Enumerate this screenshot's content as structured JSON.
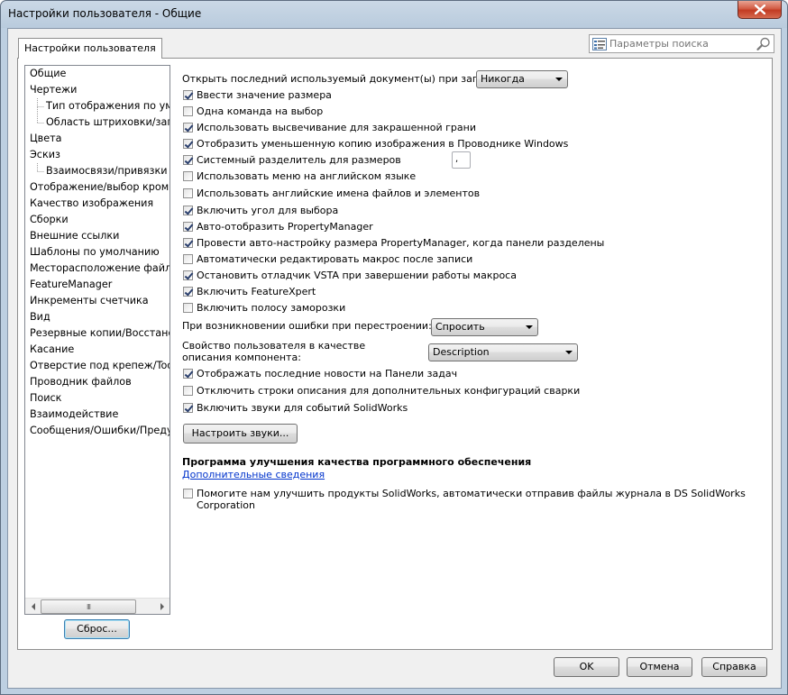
{
  "window": {
    "title": "Настройки пользователя - Общие"
  },
  "tab_label": "Настройки пользователя",
  "search": {
    "placeholder": "Параметры поиска"
  },
  "tree": {
    "items": [
      {
        "label": "Общие",
        "child": false
      },
      {
        "label": "Чертежи",
        "child": false
      },
      {
        "label": "Тип отображения по умо",
        "child": true
      },
      {
        "label": "Область штриховки/запо",
        "child": true
      },
      {
        "label": "Цвета",
        "child": false
      },
      {
        "label": "Эскиз",
        "child": false
      },
      {
        "label": "Взаимосвязи/привязки",
        "child": true
      },
      {
        "label": "Отображение/выбор кромк",
        "child": false
      },
      {
        "label": "Качество изображения",
        "child": false
      },
      {
        "label": "Сборки",
        "child": false
      },
      {
        "label": "Внешние ссылки",
        "child": false
      },
      {
        "label": "Шаблоны по умолчанию",
        "child": false
      },
      {
        "label": "Месторасположение файло",
        "child": false
      },
      {
        "label": "FeatureManager",
        "child": false
      },
      {
        "label": "Инкременты счетчика",
        "child": false
      },
      {
        "label": "Вид",
        "child": false
      },
      {
        "label": "Резервные копии/Восстанов",
        "child": false
      },
      {
        "label": "Касание",
        "child": false
      },
      {
        "label": "Отверстие под крепеж/Toolb",
        "child": false
      },
      {
        "label": "Проводник файлов",
        "child": false
      },
      {
        "label": "Поиск",
        "child": false
      },
      {
        "label": "Взаимодействие",
        "child": false
      },
      {
        "label": "Сообщения/Ошибки/Преду",
        "child": false
      }
    ],
    "scroll_thumb": "III"
  },
  "reset_button": "Сброс...",
  "open_last": {
    "label": "Открыть последний используемый документ(ы) при запуске:",
    "value": "Никогда"
  },
  "checkboxes_a": [
    {
      "label": "Ввести значение размера",
      "checked": true
    },
    {
      "label": "Одна команда на выбор",
      "checked": false
    },
    {
      "label": "Использовать высвечивание для закрашенной грани",
      "checked": true
    },
    {
      "label": "Отобразить уменьшенную копию изображения в Проводнике Windows",
      "checked": true
    },
    {
      "label": "Системный разделитель для размеров",
      "checked": true
    },
    {
      "label": "Использовать меню на английском языке",
      "checked": false
    },
    {
      "label": "Использовать английские имена файлов и элементов",
      "checked": false
    }
  ],
  "separator_value": ",",
  "checkboxes_b": [
    {
      "label": "Включить угол для выбора",
      "checked": true
    },
    {
      "label": "Авто-отобразить PropertyManager",
      "checked": true
    },
    {
      "label": "Провести авто-настройку размера PropertyManager, когда панели разделены",
      "checked": true
    },
    {
      "label": "Автоматически редактировать макрос после записи",
      "checked": false
    },
    {
      "label": "Остановить отладчик VSTA при завершении работы макроса",
      "checked": true
    },
    {
      "label": "Включить FeatureXpert",
      "checked": true
    },
    {
      "label": "Включить полосу заморозки",
      "checked": false
    }
  ],
  "rebuild_error": {
    "label": "При возникновении ошибки при перестроении:",
    "value": "Спросить"
  },
  "component_desc": {
    "label_line1": "Свойство пользователя в качестве",
    "label_line2": "описания компонента:",
    "value": "Description"
  },
  "checkboxes_c": [
    {
      "label": "Отображать последние новости на Панели задач",
      "checked": true
    },
    {
      "label": "Отключить строки описания для дополнительных конфигураций  сварки",
      "checked": false
    },
    {
      "label": "Включить звуки для событий SolidWorks",
      "checked": true
    }
  ],
  "sounds_button": "Настроить звуки...",
  "program": {
    "heading": "Программа улучшения качества программного обеспечения",
    "link": "Дополнительные сведения",
    "help_line1": "Помогите нам улучшить продукты SolidWorks, автоматически отправив файлы журнала в DS SolidWorks",
    "help_line2": "Corporation",
    "help_checked": false
  },
  "buttons": {
    "ok": "OK",
    "cancel": "Отмена",
    "help": "Справка"
  }
}
